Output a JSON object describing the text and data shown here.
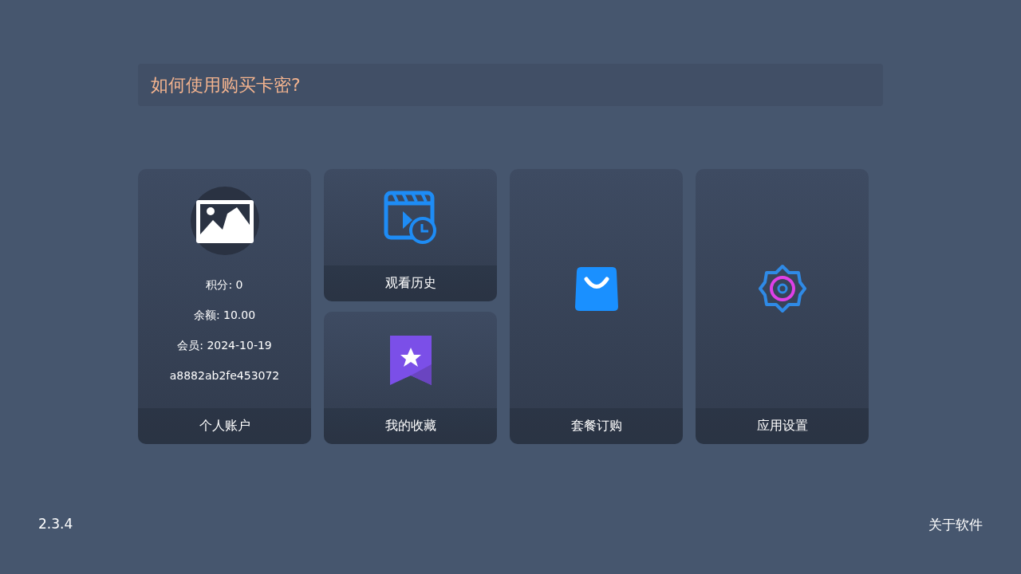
{
  "banner": {
    "title": "如何使用购买卡密?"
  },
  "tiles": [
    {
      "kind": "account",
      "label": "个人账户",
      "lines": [
        "积分: 0",
        "余额: 10.00",
        "会员: 2024-10-19",
        "a8882ab2fe453072"
      ]
    },
    {
      "kind": "history",
      "label": "观看历史"
    },
    {
      "kind": "favorites",
      "label": "我的收藏"
    },
    {
      "kind": "shop",
      "label": "套餐订购"
    },
    {
      "kind": "settings",
      "label": "应用设置"
    }
  ],
  "footer": {
    "version": "2.3.4",
    "about": "关于软件"
  }
}
